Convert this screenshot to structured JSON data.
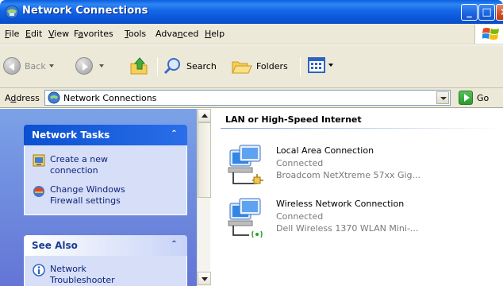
{
  "window": {
    "title": "Network Connections",
    "buttons": {
      "minimize": "_",
      "maximize": "□",
      "close": "×"
    }
  },
  "menu": [
    {
      "pre": "",
      "u": "F",
      "post": "ile"
    },
    {
      "pre": "",
      "u": "E",
      "post": "dit"
    },
    {
      "pre": "",
      "u": "V",
      "post": "iew"
    },
    {
      "pre": "F",
      "u": "a",
      "post": "vorites"
    },
    {
      "pre": "",
      "u": "T",
      "post": "ools"
    },
    {
      "pre": "Adva",
      "u": "n",
      "post": "ced"
    },
    {
      "pre": "",
      "u": "H",
      "post": "elp"
    }
  ],
  "toolbar": {
    "back_label": "Back",
    "search_label": "Search",
    "folders_label": "Folders"
  },
  "address": {
    "label_pre": "A",
    "label_u": "d",
    "label_post": "dress",
    "value": "Network Connections",
    "go_label": "Go"
  },
  "tasks_panel": {
    "title": "Network Tasks",
    "collapse_glyph": "⌃",
    "items": [
      {
        "label": "Create a new connection",
        "icon": "new-connection-icon"
      },
      {
        "label": "Change Windows Firewall settings",
        "icon": "firewall-icon"
      }
    ]
  },
  "see_also_panel": {
    "title": "See Also",
    "collapse_glyph": "⌃",
    "items": [
      {
        "label": "Network Troubleshooter",
        "icon": "info-icon"
      }
    ]
  },
  "content": {
    "group_title": "LAN or High-Speed Internet",
    "connections": [
      {
        "name": "Local Area Connection",
        "status": "Connected",
        "device": "Broadcom NetXtreme 57xx Gig...",
        "icon": "lan-connection-icon"
      },
      {
        "name": "Wireless Network Connection",
        "status": "Connected",
        "device": "Dell Wireless 1370 WLAN Mini-...",
        "icon": "wireless-connection-icon"
      }
    ]
  },
  "colors": {
    "titlebar": "#0b55d8",
    "chrome": "#ece9d8",
    "task_pane": "#7ba2e7",
    "panel_body": "#d6dff7",
    "link": "#0c1f7a"
  }
}
